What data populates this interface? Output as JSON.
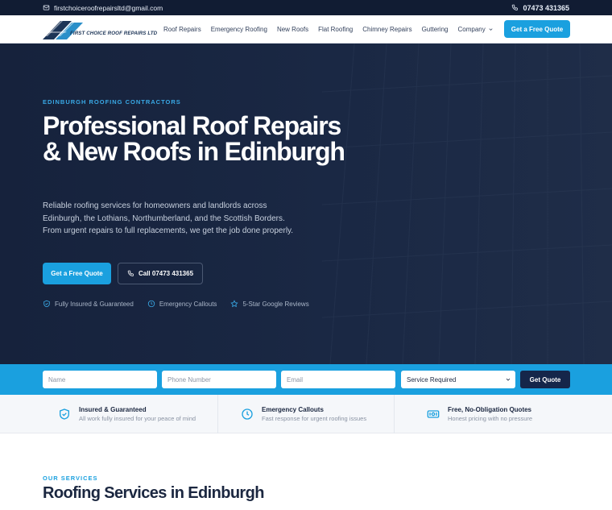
{
  "topbar": {
    "email": "firstchoiceroofrepairsltd@gmail.com",
    "phone": "07473 431365"
  },
  "nav": {
    "logo_text": "FIRST CHOICE ROOF REPAIRS LTD",
    "items": [
      "Roof Repairs",
      "Emergency Roofing",
      "New Roofs",
      "Flat Roofing",
      "Chimney Repairs",
      "Guttering",
      "Company"
    ],
    "cta": "Get a Free Quote"
  },
  "hero": {
    "eyebrow": "EDINBURGH ROOFING CONTRACTORS",
    "title": "Professional Roof Repairs & New Roofs in Edinburgh",
    "description": "Reliable roofing services for homeowners and landlords across Edinburgh, the Lothians, Northumberland, and the Scottish Borders. From urgent repairs to full replacements, we get the job done properly.",
    "primary_button": "Get a Free Quote",
    "call_button": "Call 07473 431365",
    "badges": [
      "Fully Insured & Guaranteed",
      "Emergency Callouts",
      "5-Star Google Reviews"
    ]
  },
  "quote_form": {
    "name_placeholder": "Name",
    "phone_placeholder": "Phone Number",
    "email_placeholder": "Email",
    "service_selected": "Service Required",
    "submit": "Get Quote"
  },
  "features": [
    {
      "title": "Insured & Guaranteed",
      "desc": "All work fully insured for your peace of mind"
    },
    {
      "title": "Emergency Callouts",
      "desc": "Fast response for urgent roofing issues"
    },
    {
      "title": "Free, No-Obligation Quotes",
      "desc": "Honest pricing with no pressure"
    }
  ],
  "services": {
    "eyebrow": "OUR SERVICES",
    "title": "Roofing Services in Edinburgh"
  },
  "colors": {
    "accent": "#1aa0df",
    "dark": "#111c33",
    "hero_bg": "#1a2844"
  }
}
